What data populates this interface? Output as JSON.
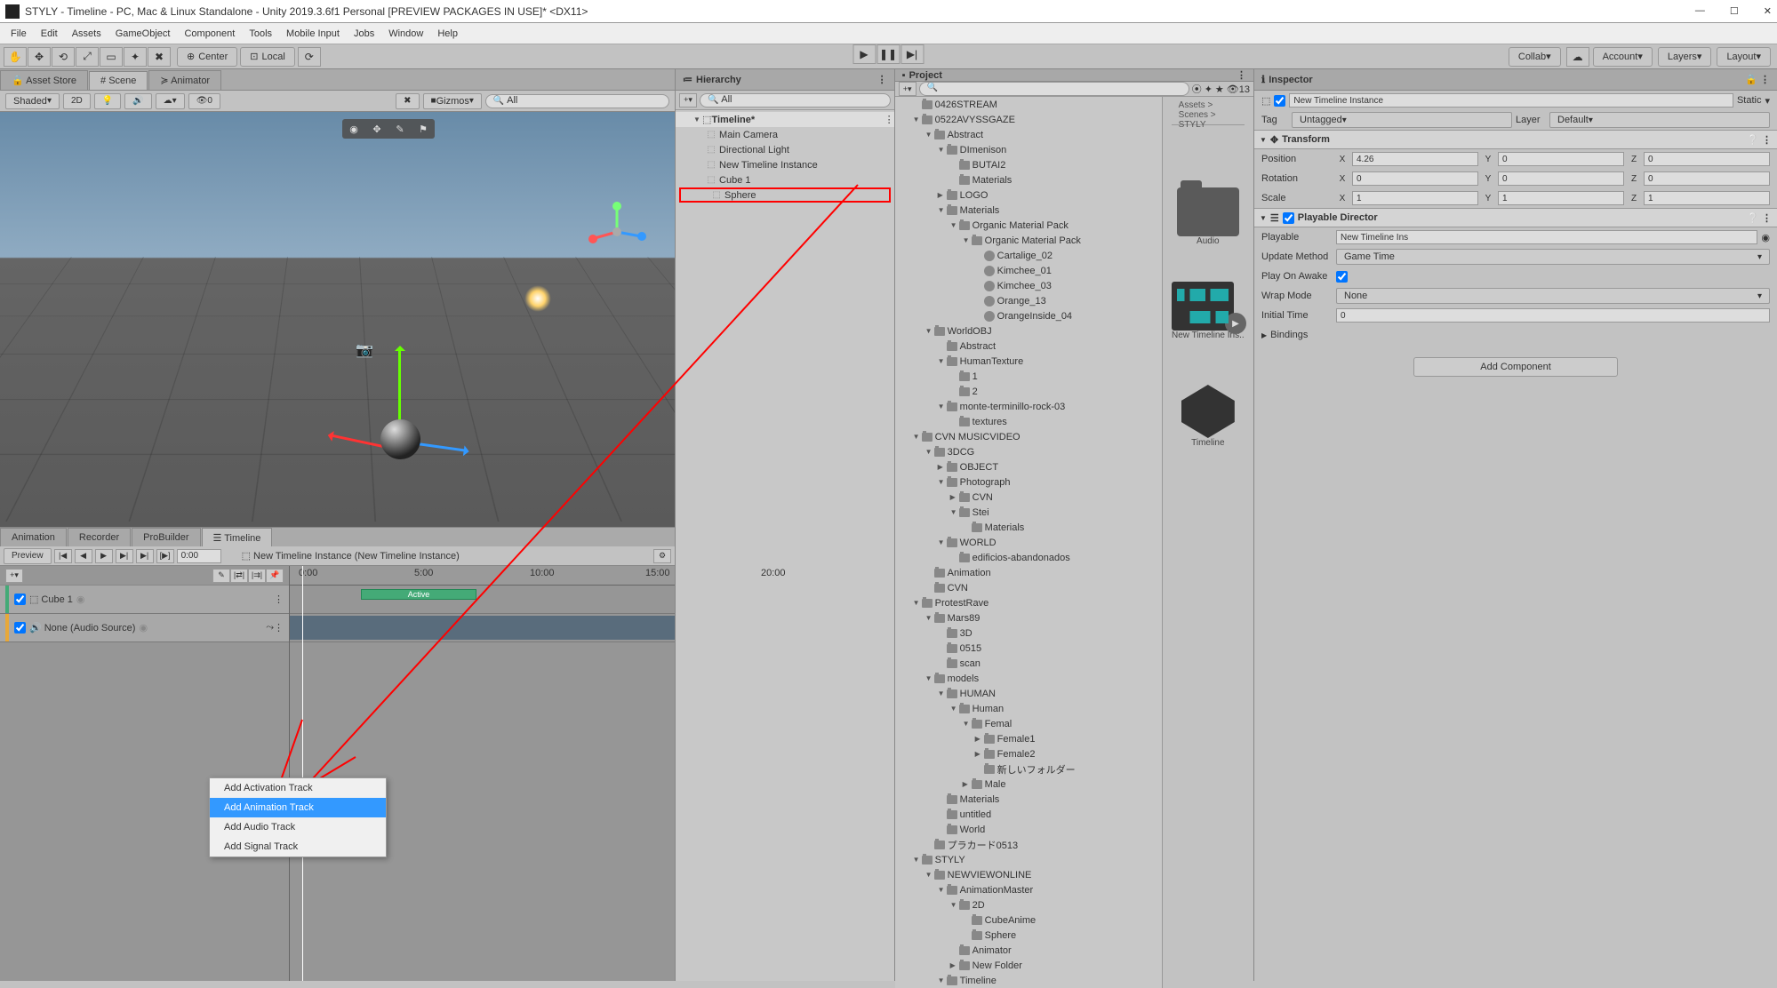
{
  "window": {
    "title": "STYLY - Timeline - PC, Mac & Linux Standalone - Unity 2019.3.6f1 Personal [PREVIEW PACKAGES IN USE]* <DX11>"
  },
  "menu": [
    "File",
    "Edit",
    "Assets",
    "GameObject",
    "Component",
    "Tools",
    "Mobile Input",
    "Jobs",
    "Window",
    "Help"
  ],
  "toolbar": {
    "center_label": "Center",
    "local_label": "Local",
    "collab": "Collab",
    "account": "Account",
    "layers": "Layers",
    "layout": "Layout"
  },
  "sceneTabs": [
    "Asset Store",
    "Scene",
    "Animator"
  ],
  "sceneBar": {
    "shading": "Shaded",
    "mode2d": "2D",
    "gizmos": "Gizmos",
    "search": "All"
  },
  "timelineTabs": [
    "Animation",
    "Recorder",
    "ProBuilder",
    "Timeline"
  ],
  "tlHeader": {
    "preview": "Preview",
    "time": "0:00",
    "instance": "New Timeline Instance (New Timeline Instance)"
  },
  "tracks": [
    {
      "name": "Cube 1",
      "color": "#4a7",
      "checked": true,
      "type": "activation"
    },
    {
      "name": "None (Audio Source)",
      "color": "#e8a838",
      "checked": true,
      "type": "audio"
    }
  ],
  "ruler": [
    "0:00",
    "5:00",
    "10:00",
    "15:00",
    "20:00"
  ],
  "clip_active": "Active",
  "contextMenu": [
    "Add Activation Track",
    "Add Animation Track",
    "Add Audio Track",
    "Add Signal Track"
  ],
  "hierarchy": {
    "title": "Hierarchy",
    "search": "All",
    "root": "Timeline*",
    "items": [
      "Main Camera",
      "Directional Light",
      "New Timeline Instance",
      "Cube 1",
      "Sphere"
    ]
  },
  "project": {
    "title": "Project",
    "search": "",
    "favCount": "13",
    "breadcrumb": "Assets > Scenes > STYLY",
    "thumbs": [
      "Audio",
      "New Timeline Ins..",
      "Timeline"
    ],
    "tree": [
      {
        "l": 1,
        "t": "folder",
        "n": "0426STREAM"
      },
      {
        "l": 1,
        "t": "folder-open",
        "n": "0522AVYSSGAZE"
      },
      {
        "l": 2,
        "t": "folder-open",
        "n": "Abstract"
      },
      {
        "l": 3,
        "t": "folder-open",
        "n": "DImenison"
      },
      {
        "l": 4,
        "t": "folder",
        "n": "BUTAI2"
      },
      {
        "l": 4,
        "t": "folder",
        "n": "Materials"
      },
      {
        "l": 3,
        "t": "folder-c",
        "n": "LOGO"
      },
      {
        "l": 3,
        "t": "folder-open",
        "n": "Materials"
      },
      {
        "l": 4,
        "t": "folder-open",
        "n": "Organic Material Pack"
      },
      {
        "l": 5,
        "t": "folder-open",
        "n": "Organic Material Pack"
      },
      {
        "l": 6,
        "t": "mat",
        "n": "Cartalige_02"
      },
      {
        "l": 6,
        "t": "mat",
        "n": "Kimchee_01"
      },
      {
        "l": 6,
        "t": "mat",
        "n": "Kimchee_03"
      },
      {
        "l": 6,
        "t": "mat",
        "n": "Orange_13"
      },
      {
        "l": 6,
        "t": "mat",
        "n": "OrangeInside_04"
      },
      {
        "l": 2,
        "t": "folder-open",
        "n": "WorldOBJ"
      },
      {
        "l": 3,
        "t": "folder",
        "n": "Abstract"
      },
      {
        "l": 3,
        "t": "folder-open",
        "n": "HumanTexture"
      },
      {
        "l": 4,
        "t": "folder",
        "n": "1"
      },
      {
        "l": 4,
        "t": "folder",
        "n": "2"
      },
      {
        "l": 3,
        "t": "folder-open",
        "n": "monte-terminillo-rock-03"
      },
      {
        "l": 4,
        "t": "folder",
        "n": "textures"
      },
      {
        "l": 1,
        "t": "folder-open",
        "n": "CVN MUSICVIDEO"
      },
      {
        "l": 2,
        "t": "folder-open",
        "n": "3DCG"
      },
      {
        "l": 3,
        "t": "folder-c",
        "n": "OBJECT"
      },
      {
        "l": 3,
        "t": "folder-open",
        "n": "Photograph"
      },
      {
        "l": 4,
        "t": "folder-c",
        "n": "CVN"
      },
      {
        "l": 4,
        "t": "folder-open",
        "n": "Stei"
      },
      {
        "l": 5,
        "t": "folder",
        "n": "Materials"
      },
      {
        "l": 3,
        "t": "folder-open",
        "n": "WORLD"
      },
      {
        "l": 4,
        "t": "folder",
        "n": "edificios-abandonados"
      },
      {
        "l": 2,
        "t": "folder",
        "n": "Animation"
      },
      {
        "l": 2,
        "t": "folder",
        "n": "CVN"
      },
      {
        "l": 1,
        "t": "folder-open",
        "n": "ProtestRave"
      },
      {
        "l": 2,
        "t": "folder-open",
        "n": "Mars89"
      },
      {
        "l": 3,
        "t": "folder",
        "n": "3D"
      },
      {
        "l": 3,
        "t": "folder",
        "n": "0515"
      },
      {
        "l": 3,
        "t": "folder",
        "n": "scan"
      },
      {
        "l": 2,
        "t": "folder-open",
        "n": "models"
      },
      {
        "l": 3,
        "t": "folder-open",
        "n": "HUMAN"
      },
      {
        "l": 4,
        "t": "folder-open",
        "n": "Human"
      },
      {
        "l": 5,
        "t": "folder-open",
        "n": "Femal"
      },
      {
        "l": 6,
        "t": "folder-c",
        "n": "Female1"
      },
      {
        "l": 6,
        "t": "folder-c",
        "n": "Female2"
      },
      {
        "l": 6,
        "t": "folder",
        "n": "新しいフォルダー"
      },
      {
        "l": 5,
        "t": "folder-c",
        "n": "Male"
      },
      {
        "l": 3,
        "t": "folder",
        "n": "Materials"
      },
      {
        "l": 3,
        "t": "folder",
        "n": "untitled"
      },
      {
        "l": 3,
        "t": "folder",
        "n": "World"
      },
      {
        "l": 2,
        "t": "folder",
        "n": "プラカード0513"
      },
      {
        "l": 1,
        "t": "folder-open",
        "n": "STYLY"
      },
      {
        "l": 2,
        "t": "folder-open",
        "n": "NEWVIEWONLINE"
      },
      {
        "l": 3,
        "t": "folder-open",
        "n": "AnimationMaster"
      },
      {
        "l": 4,
        "t": "folder-open",
        "n": "2D"
      },
      {
        "l": 5,
        "t": "folder",
        "n": "CubeAnime"
      },
      {
        "l": 5,
        "t": "folder",
        "n": "Sphere"
      },
      {
        "l": 4,
        "t": "folder",
        "n": "Animator"
      },
      {
        "l": 4,
        "t": "folder-c",
        "n": "New Folder"
      },
      {
        "l": 3,
        "t": "folder-open",
        "n": "Timeline"
      }
    ]
  },
  "inspector": {
    "title": "Inspector",
    "objName": "New Timeline Instance",
    "static": "Static",
    "tag": "Tag",
    "tagVal": "Untagged",
    "layer": "Layer",
    "layerVal": "Default",
    "transform": {
      "title": "Transform",
      "pos": {
        "label": "Position",
        "x": "4.26",
        "y": "0",
        "z": "0"
      },
      "rot": {
        "label": "Rotation",
        "x": "0",
        "y": "0",
        "z": "0"
      },
      "scl": {
        "label": "Scale",
        "x": "1",
        "y": "1",
        "z": "1"
      }
    },
    "director": {
      "title": "Playable Director",
      "playable": {
        "label": "Playable",
        "val": "New Timeline Ins"
      },
      "update": {
        "label": "Update Method",
        "val": "Game Time"
      },
      "awake": {
        "label": "Play On Awake",
        "val": true
      },
      "wrap": {
        "label": "Wrap Mode",
        "val": "None"
      },
      "initial": {
        "label": "Initial Time",
        "val": "0"
      },
      "bindings": "Bindings"
    },
    "addComp": "Add Component"
  }
}
